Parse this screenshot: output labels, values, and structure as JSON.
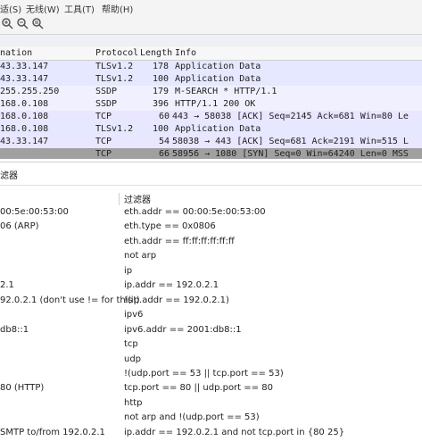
{
  "menubar": {
    "items": [
      "适(S)",
      "无线(W)",
      "工具(T)",
      "帮助(H)"
    ]
  },
  "toolbar": {
    "icons": [
      "zoom-in-icon",
      "zoom-out-icon",
      "zoom-reset-icon"
    ]
  },
  "packet_list": {
    "headers": {
      "destination": "nation",
      "protocol": "Protocol",
      "length": "Length",
      "info": "Info"
    },
    "rows": [
      {
        "destination": "43.33.147",
        "protocol": "TLSv1.2",
        "length": "178",
        "info": "Application Data",
        "color": "#e6e8ff"
      },
      {
        "destination": "43.33.147",
        "protocol": "TLSv1.2",
        "length": "100",
        "info": "Application Data",
        "color": "#e6e8ff"
      },
      {
        "destination": "255.255.250",
        "protocol": "SSDP",
        "length": "179",
        "info": "M-SEARCH * HTTP/1.1",
        "color": "#f0f0ff"
      },
      {
        "destination": "168.0.108",
        "protocol": "SSDP",
        "length": "396",
        "info": "HTTP/1.1 200 OK",
        "color": "#f0f0ff"
      },
      {
        "destination": "168.0.108",
        "protocol": "TCP",
        "length": "60",
        "info": "443 → 58038 [ACK] Seq=2145 Ack=681 Win=80 Le",
        "color": "#e9e6ff"
      },
      {
        "destination": "168.0.108",
        "protocol": "TLSv1.2",
        "length": "100",
        "info": "Application Data",
        "color": "#e6e8ff"
      },
      {
        "destination": "43.33.147",
        "protocol": "TCP",
        "length": "54",
        "info": "58038 → 443 [ACK] Seq=681 Ack=2191 Win=515 L",
        "color": "#e9e6ff"
      },
      {
        "destination": "",
        "protocol": "TCP",
        "length": "66",
        "info": "58956 → 1080 [SYN] Seq=0 Win=64240 Len=0 MSS",
        "color": "#a0a0a0"
      }
    ]
  },
  "dialog": {
    "title": "滤器"
  },
  "filters": {
    "header_left": "",
    "header_right": "过滤器",
    "rows": [
      {
        "name": "00:5e:00:53:00",
        "filter": "eth.addr == 00:00:5e:00:53:00"
      },
      {
        "name": "06 (ARP)",
        "filter": "eth.type == 0x0806"
      },
      {
        "name": "",
        "filter": "eth.addr == ff:ff:ff:ff:ff:ff"
      },
      {
        "name": "",
        "filter": "not arp"
      },
      {
        "name": "",
        "filter": "ip"
      },
      {
        "name": "2.1",
        "filter": "ip.addr == 192.0.2.1"
      },
      {
        "name": "92.0.2.1 (don't use != for this!)",
        "filter": "!(ip.addr == 192.0.2.1)"
      },
      {
        "name": "",
        "filter": "ipv6"
      },
      {
        "name": "db8::1",
        "filter": "ipv6.addr == 2001:db8::1"
      },
      {
        "name": "",
        "filter": "tcp"
      },
      {
        "name": "",
        "filter": "udp"
      },
      {
        "name": "",
        "filter": "!(udp.port == 53 || tcp.port == 53)"
      },
      {
        "name": "80 (HTTP)",
        "filter": "tcp.port == 80 || udp.port == 80"
      },
      {
        "name": "",
        "filter": "http"
      },
      {
        "name": "",
        "filter": "not arp and !(udp.port == 53)"
      },
      {
        "name": "SMTP to/from 192.0.2.1",
        "filter": "ip.addr == 192.0.2.1 and not tcp.port in {80 25}"
      }
    ]
  }
}
